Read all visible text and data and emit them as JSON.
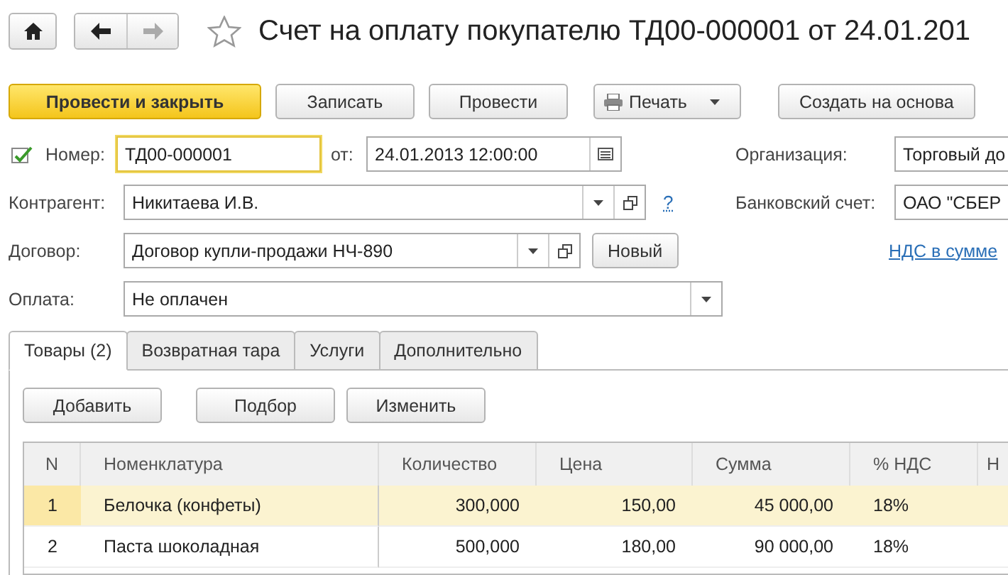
{
  "window": {
    "title": "Счет на оплату покупателю ТД00-000001 от 24.01.201",
    "favorite": false
  },
  "toolbar": [
    {
      "label": "Провести и закрыть",
      "kind": "primary"
    },
    {
      "label": "Записать",
      "kind": "plain"
    },
    {
      "label": "Провести",
      "kind": "plain"
    },
    {
      "label": "Печать",
      "kind": "print"
    },
    {
      "label": "Создать на основа",
      "kind": "plain"
    }
  ],
  "form": {
    "number": {
      "label": "Номер:",
      "value": "ТД00-000001",
      "focused": true
    },
    "date": {
      "label": "от:",
      "value": "24.01.2013 12:00:00"
    },
    "organization": {
      "label": "Организация:",
      "value": "Торговый до"
    },
    "counterparty": {
      "label": "Контрагент:",
      "value": "Никитаева И.В.",
      "help": "?"
    },
    "bank_account": {
      "label": "Банковский счет:",
      "value": "ОАО \"СБЕР"
    },
    "contract": {
      "label": "Договор:",
      "value": "Договор купли-продажи НЧ-890",
      "button": "Новый"
    },
    "vat_link": "НДС в сумме",
    "payment": {
      "label": "Оплата:",
      "value": "Не оплачен"
    }
  },
  "tabs": [
    {
      "label": "Товары (2)",
      "selected": true
    },
    {
      "label": "Возвратная тара",
      "selected": false
    },
    {
      "label": "Услуги",
      "selected": false
    },
    {
      "label": "Дополнительно",
      "selected": false
    }
  ],
  "table_buttons": [
    "Добавить",
    "Подбор",
    "Изменить"
  ],
  "table": {
    "columns": [
      "N",
      "Номенклатура",
      "Количество",
      "Цена",
      "Сумма",
      "% НДС",
      "Н"
    ],
    "rows": [
      {
        "cells": [
          "1",
          "Белочка (конфеты)",
          "300,000",
          "150,00",
          "45 000,00",
          "18%"
        ],
        "selected": true
      },
      {
        "cells": [
          "2",
          "Паста шоколадная",
          "500,000",
          "180,00",
          "90 000,00",
          "18%"
        ],
        "selected": false
      }
    ]
  }
}
